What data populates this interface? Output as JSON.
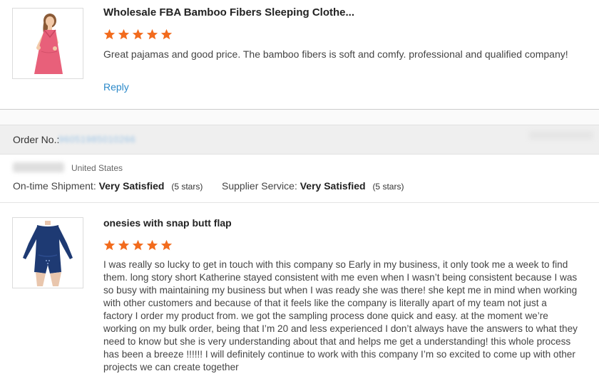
{
  "reviews": [
    {
      "product_title": "Wholesale FBA Bamboo Fibers Sleeping Clothe...",
      "rating": 5,
      "text": "Great pajamas and good price. The bamboo fibers is soft and comfy. professional and qualified company!",
      "reply_label": "Reply"
    },
    {
      "product_title": "onesies with snap butt flap",
      "rating": 5,
      "text": "I was really so lucky to get in touch with this company so Early in my business, it only took me a week to find them. long story short Katherine stayed consistent with me even when I wasn’t being consistent because I was so busy with maintaining my business but when I was ready she was there!  she kept me in mind when working with other customers and because of that it feels like the company is literally apart of my team not just a factory I order my product from. we got the sampling process done quick and easy. at the moment we’re working on my bulk order, being that I’m 20 and less experienced I don’t always have the answers to what they need to know but she is very understanding about that and helps me get a understanding! this whole process has been a breeze !!!!!! I will definitely continue to work with this company I’m so excited to come up with other projects we can create together"
    }
  ],
  "order": {
    "label": "Order No.:",
    "number": "96051985010266"
  },
  "buyer": {
    "country": "United States"
  },
  "ratings": {
    "shipment_label": "On-time Shipment:",
    "shipment_value": "Very Satisfied",
    "shipment_stars": "(5 stars)",
    "service_label": "Supplier Service:",
    "service_value": "Very Satisfied",
    "service_stars": "(5 stars)"
  },
  "colors": {
    "star": "#f26b1d",
    "link": "#2b89c9",
    "dress": "#e8607a",
    "romper": "#1e3a73"
  }
}
